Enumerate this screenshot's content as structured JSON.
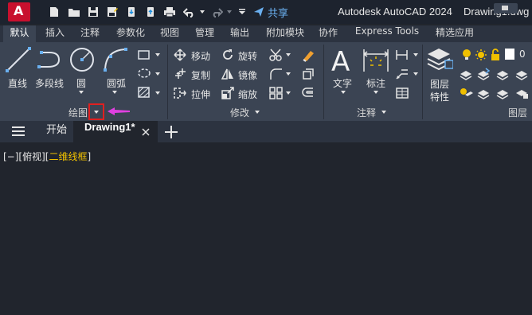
{
  "app": {
    "logo_letter": "A",
    "product": "Autodesk AutoCAD 2024",
    "file": "Drawing1.dwg",
    "share_label": "共享",
    "accent_red": "#c8102e",
    "share_color": "#6ab0f0"
  },
  "ribbon_tabs": [
    {
      "label": "默认",
      "active": true
    },
    {
      "label": "插入"
    },
    {
      "label": "注释"
    },
    {
      "label": "参数化"
    },
    {
      "label": "视图"
    },
    {
      "label": "管理"
    },
    {
      "label": "输出"
    },
    {
      "label": "附加模块"
    },
    {
      "label": "协作"
    },
    {
      "label": "Express Tools"
    },
    {
      "label": "精选应用"
    }
  ],
  "draw_panel": {
    "title": "绘图",
    "tools": {
      "line": "直线",
      "polyline": "多段线",
      "circle": "圆",
      "arc": "圆弧"
    }
  },
  "modify_panel": {
    "title": "修改",
    "tools": {
      "move": "移动",
      "rotate": "旋转",
      "copy": "复制",
      "mirror": "镜像",
      "stretch": "拉伸",
      "scale": "缩放"
    }
  },
  "annotation_panel": {
    "title": "注释",
    "tools": {
      "text": "文字",
      "dimension": "标注"
    }
  },
  "layers_panel": {
    "title": "图层",
    "tools": {
      "layer_properties_1": "图层",
      "layer_properties_2": "特性"
    },
    "current_layer": "0"
  },
  "document_tabs": {
    "start": "开始",
    "active": "Drawing1*"
  },
  "viewport": {
    "prefix": "[−][俯视][",
    "visual_style": "二维线框",
    "suffix": "]",
    "visual_style_color": "#f0c000"
  },
  "annotation_marker": {
    "highlight_color": "#e02020",
    "arrow_color": "#e040e0"
  }
}
